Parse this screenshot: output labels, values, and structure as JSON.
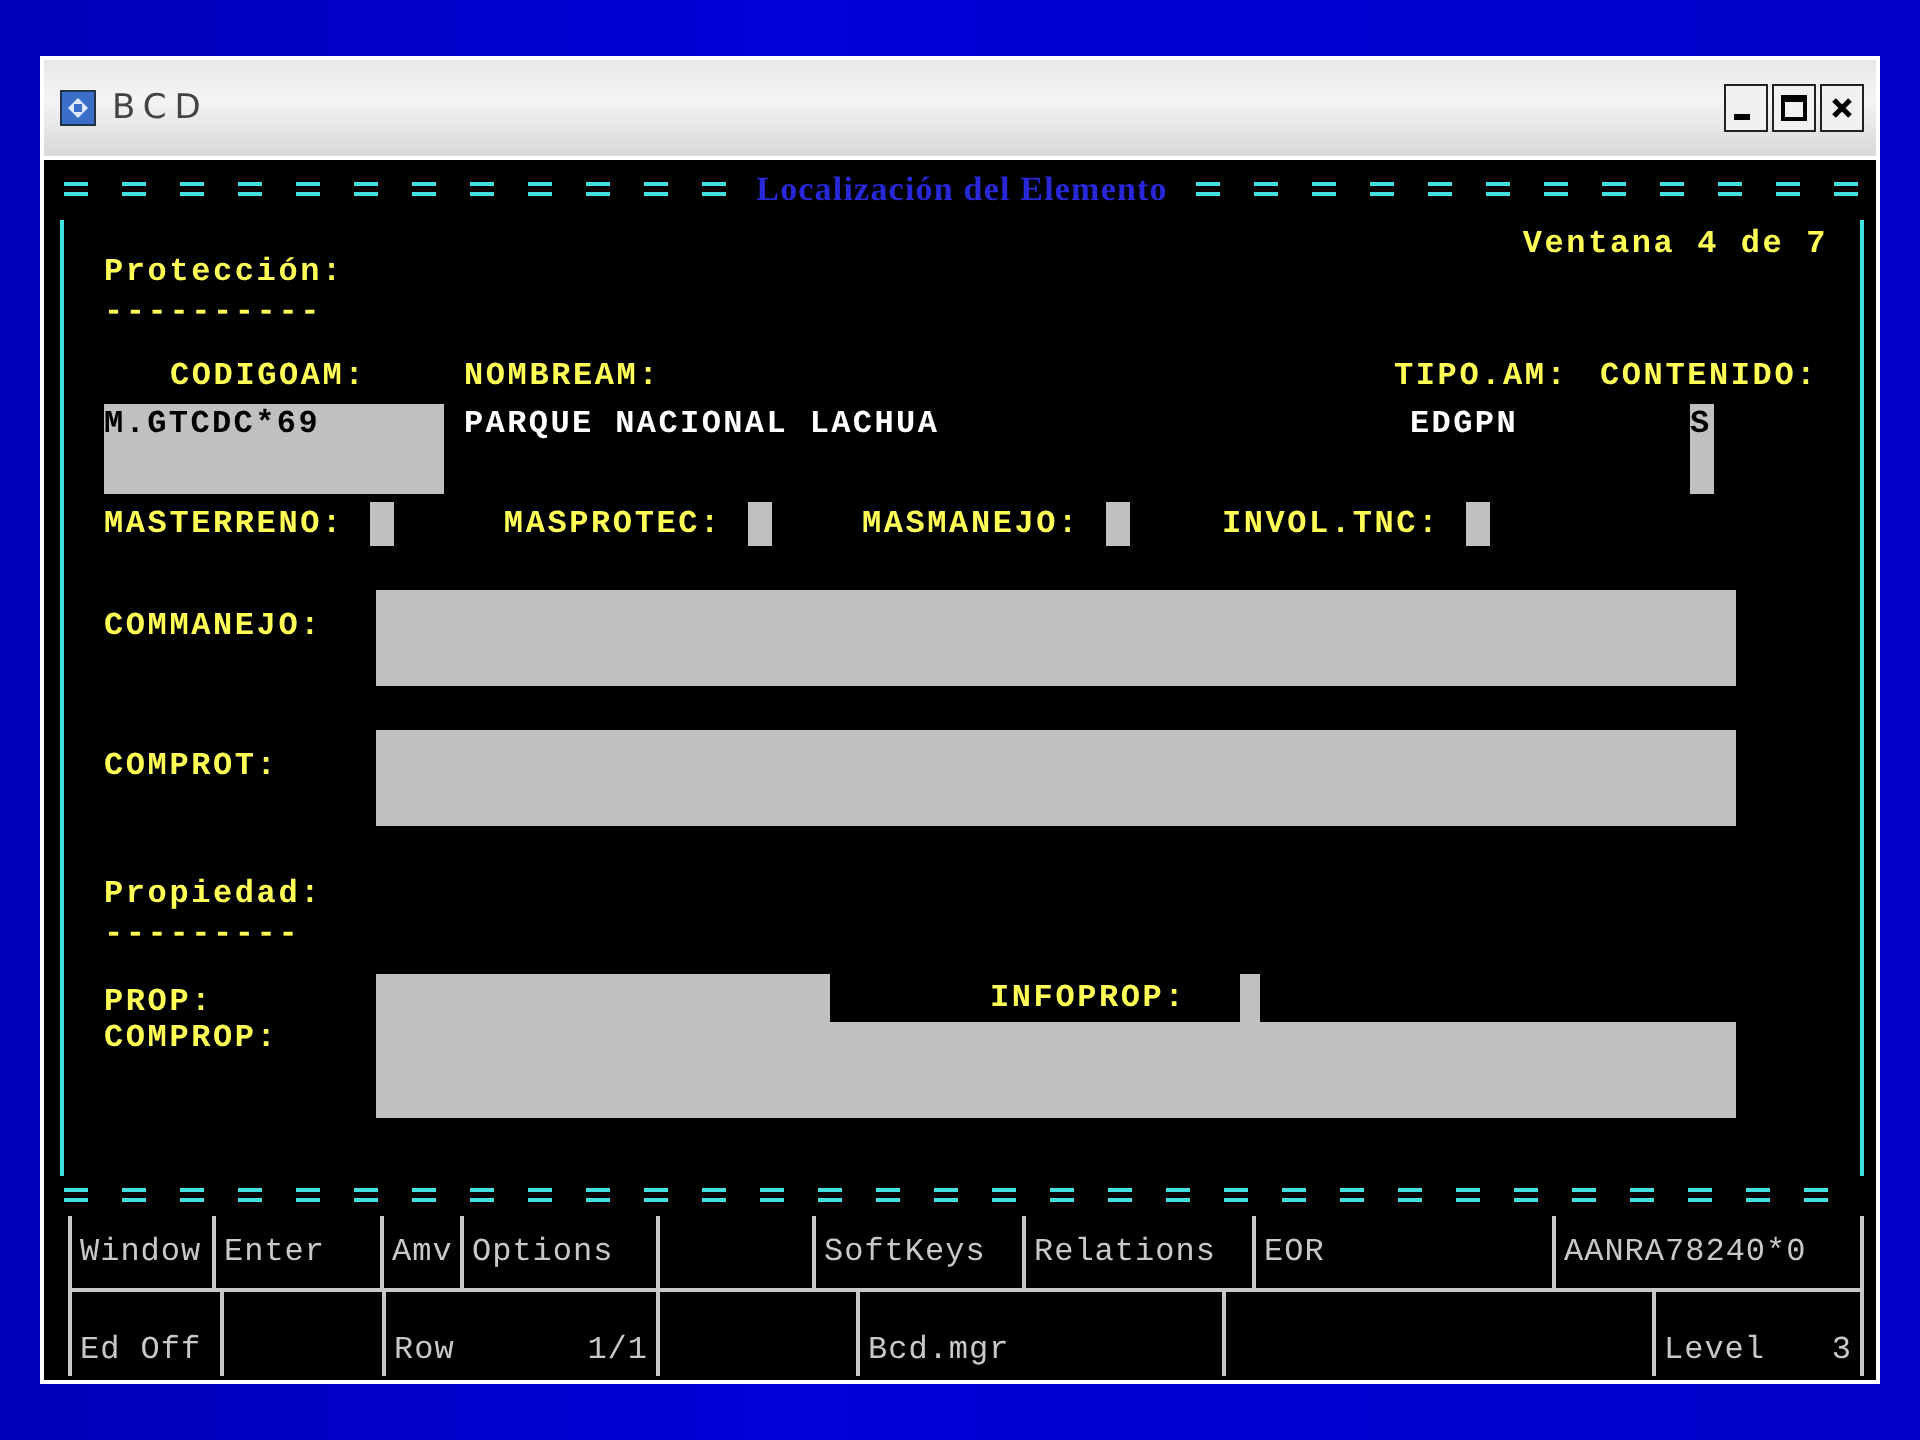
{
  "window": {
    "title": "BCD"
  },
  "screen": {
    "title": "Localización del Elemento",
    "window_indicator": "Ventana 4 de 7"
  },
  "proteccion": {
    "heading": "Protección:",
    "rule": "----------",
    "codigoam": {
      "label": "CODIGOAM:",
      "value": "M.GTCDC*69"
    },
    "nombream": {
      "label": "NOMBREAM:",
      "value": "PARQUE NACIONAL LACHUA"
    },
    "tipo_am": {
      "label": "TIPO.AM:",
      "value": "EDGPN"
    },
    "contenido": {
      "label": "CONTENIDO:",
      "value": "S"
    },
    "flags": [
      {
        "label": "MASTERRENO:"
      },
      {
        "label": "MASPROTEC:"
      },
      {
        "label": "MASMANEJO:"
      },
      {
        "label": "INVOL.TNC:"
      }
    ],
    "commanejo": {
      "label": "COMMANEJO:"
    },
    "comprot": {
      "label": "COMPROT:"
    }
  },
  "propiedad": {
    "heading": "Propiedad:",
    "rule": "---------",
    "prop": {
      "label": "PROP:"
    },
    "infoprop": {
      "label": "INFOPROP:"
    },
    "comprop": {
      "label": "COMPROP:"
    }
  },
  "status_bar": {
    "row_1": [
      {
        "kind": "text",
        "text": "Window"
      },
      {
        "kind": "text",
        "text": "Enter"
      },
      {
        "kind": "text",
        "text": "Amv"
      },
      {
        "kind": "text",
        "text": "Options"
      },
      {
        "kind": "blank"
      },
      {
        "kind": "text",
        "text": "SoftKeys"
      },
      {
        "kind": "text",
        "text": "Relations"
      },
      {
        "kind": "text",
        "text": "EOR"
      },
      {
        "kind": "text",
        "text": "AANRA78240*0"
      }
    ],
    "row_2": [
      {
        "kind": "text",
        "text": "Ed Off"
      },
      {
        "kind": "blank"
      },
      {
        "kind": "pair",
        "label": "Row",
        "value": "1/1"
      },
      {
        "kind": "blank"
      },
      {
        "kind": "text",
        "text": "Bcd.mgr"
      },
      {
        "kind": "blank"
      },
      {
        "kind": "pair",
        "label": "Level",
        "value": "3"
      }
    ]
  }
}
